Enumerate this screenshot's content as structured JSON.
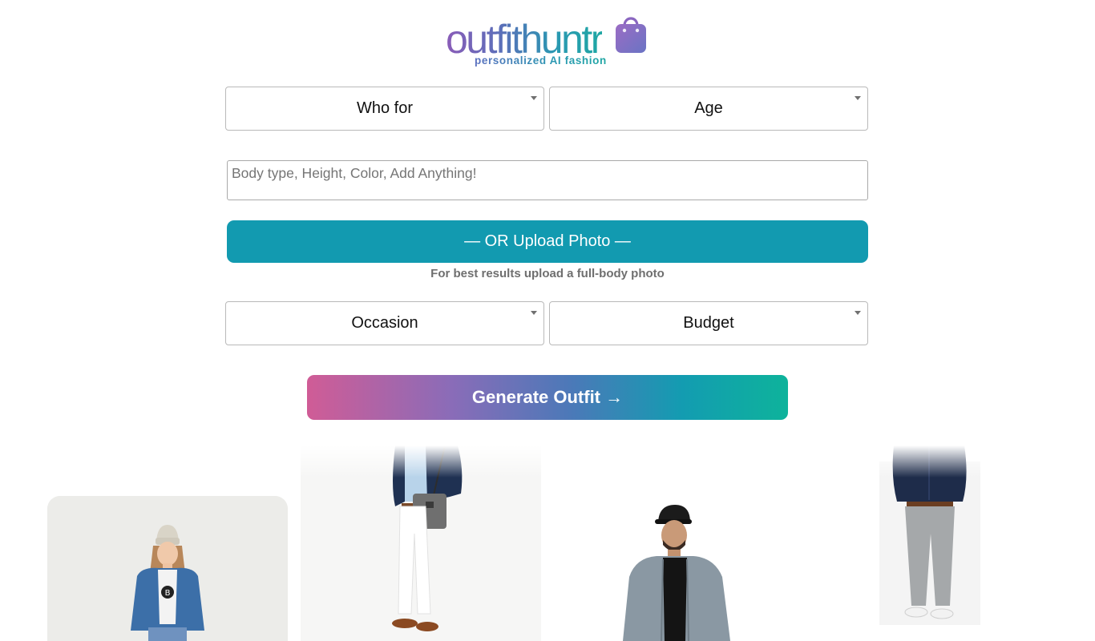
{
  "brand": {
    "name": "outfithuntr",
    "tagline": "personalized AI fashion"
  },
  "filters": {
    "who_for": "Who for",
    "age": "Age",
    "occasion": "Occasion",
    "budget": "Budget"
  },
  "details": {
    "placeholder": "Body type, Height, Color, Add Anything!",
    "value": ""
  },
  "upload": {
    "label": "— OR Upload Photo —",
    "hint": "For best results upload a full-body photo"
  },
  "generate": {
    "label": "Generate Outfit →"
  },
  "colors": {
    "upload_button": "#129ab0",
    "generate_gradient_start": "#d05c96",
    "generate_gradient_end": "#0eb39b",
    "brand_purple": "#8a5cb8",
    "brand_teal": "#1fa7a4"
  },
  "gallery": [
    {
      "icon": "girl-denim-jacket-beanie-photo"
    },
    {
      "icon": "man-navy-blazer-white-jeans-bag-photo"
    },
    {
      "icon": "man-grey-hoodie-black-cap-photo"
    },
    {
      "icon": "man-navy-shirt-grey-chinos-photo"
    }
  ]
}
